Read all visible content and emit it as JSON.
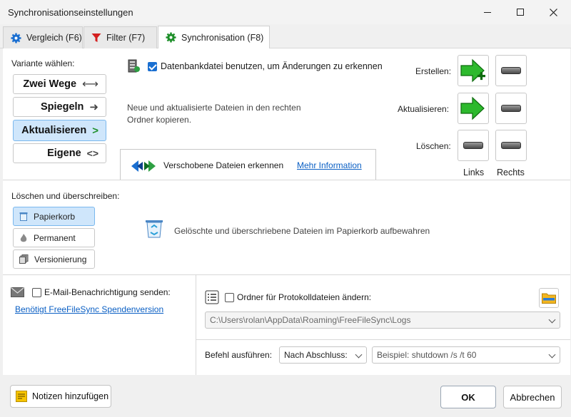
{
  "window": {
    "title": "Synchronisationseinstellungen"
  },
  "tabs": [
    {
      "label": "Vergleich (F6)",
      "icon": "gear-icon",
      "color": "#1a6fd1"
    },
    {
      "label": "Filter (F7)",
      "icon": "filter-icon",
      "color": "#d42020"
    },
    {
      "label": "Synchronisation (F8)",
      "icon": "gear-icon",
      "color": "#1e8f2a"
    }
  ],
  "variant": {
    "label": "Variante wählen:",
    "options": [
      {
        "label": "Zwei Wege",
        "symbol": "⟷"
      },
      {
        "label": "Spiegeln",
        "symbol": "➜"
      },
      {
        "label": "Aktualisieren",
        "symbol": ">"
      },
      {
        "label": "Eigene",
        "symbol": "<>"
      }
    ],
    "selected": "Aktualisieren"
  },
  "database": {
    "label": "Datenbankdatei benutzen, um Änderungen zu erkennen",
    "checked": true
  },
  "description": "Neue und aktualisierte Dateien in den rechten Ordner kopieren.",
  "moved_files": {
    "label": "Verschobene Dateien erkennen",
    "link": "Mehr Information"
  },
  "actions": {
    "rows": [
      "Erstellen:",
      "Aktualisieren:",
      "Löschen:"
    ],
    "columns": [
      "Links",
      "Rechts"
    ]
  },
  "delete_overwrite": {
    "label": "Löschen und überschreiben:",
    "options": [
      "Papierkorb",
      "Permanent",
      "Versionierung"
    ],
    "selected": "Papierkorb",
    "description": "Gelöschte und überschriebene Dateien im Papierkorb aufbewahren"
  },
  "email": {
    "label": "E-Mail-Benachrichtigung senden:",
    "link": "Benötigt FreeFileSync Spendenversion",
    "checked": false
  },
  "log_folder": {
    "label": "Ordner für Protokolldateien ändern:",
    "path": "C:\\Users\\rolan\\AppData\\Roaming\\FreeFileSync\\Logs",
    "checked": false
  },
  "command": {
    "label": "Befehl ausführen:",
    "when": "Nach Abschluss:",
    "placeholder": "Beispiel: shutdown /s /t 60"
  },
  "footer": {
    "notes": "Notizen hinzufügen",
    "ok": "OK",
    "cancel": "Abbrechen"
  }
}
